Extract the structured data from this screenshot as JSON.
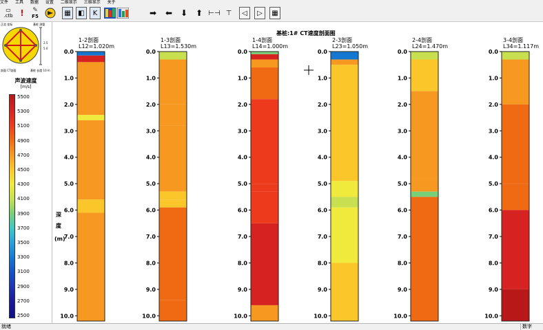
{
  "menu": [
    "文件",
    "工具",
    "数据",
    "设置",
    "二维显示",
    "三维显示",
    "关于"
  ],
  "toolbar": {
    "ctb_label": ".ctb",
    "f5_label": "F5",
    "icons": [
      "open-file-icon",
      "alert-icon",
      "run-icon",
      "profile-select-icon",
      "pattern-icon",
      "edit-icon",
      "color-map-icon",
      "multi-color-icon",
      "arrow-right-icon",
      "arrow-left-icon",
      "arrow-down-icon",
      "arrow-up-icon",
      "fit-width-icon",
      "fit-height-icon",
      "page-left-icon",
      "page-right-icon",
      "grid-icon"
    ]
  },
  "compass": {
    "top_left": "正北 坐标",
    "top_right": "基桩 测管",
    "bottom_left": "剖面 CT剖面",
    "bottom_right": "基桩 长度 10 m",
    "right_values": [
      "2.5",
      "5.0"
    ]
  },
  "legend": {
    "title": "声波速度",
    "unit": "[m/s]",
    "values": [
      5500,
      5300,
      5100,
      4900,
      4700,
      4500,
      4300,
      4100,
      3900,
      3700,
      3500,
      3300,
      3100,
      2900,
      2700,
      2500
    ],
    "colors": [
      "#b81818",
      "#d72222",
      "#ee3a1c",
      "#f06a14",
      "#f79820",
      "#fbc62a",
      "#f0ea3c",
      "#c8e050",
      "#78d078",
      "#3cc8c8",
      "#28a0dc",
      "#1478d2",
      "#1450c8",
      "#1e32b4",
      "#19199a",
      "#10108a"
    ]
  },
  "chart_data": {
    "type": "heatmap",
    "title": "基桩:1# CT速度剖面图",
    "ylabel": "深度 (m)",
    "ylim": [
      0.0,
      10.2
    ],
    "yticks": [
      "0.0",
      "1.0",
      "2.0",
      "3.0",
      "4.0",
      "5.0",
      "6.0",
      "7.0",
      "8.0",
      "9.0",
      "10.0"
    ],
    "profiles": [
      {
        "name": "1-2剖面",
        "length": "L12=1.020m",
        "segments": [
          [
            0.0,
            0.15,
            3200
          ],
          [
            0.15,
            0.4,
            5300
          ],
          [
            0.4,
            2.4,
            4700
          ],
          [
            2.4,
            2.6,
            4200
          ],
          [
            2.6,
            5.6,
            4600
          ],
          [
            5.6,
            6.1,
            4400
          ],
          [
            6.1,
            10.2,
            4600
          ]
        ]
      },
      {
        "name": "1-3剖面",
        "length": "L13=1.530m",
        "segments": [
          [
            0.0,
            0.3,
            4100
          ],
          [
            0.3,
            2.0,
            4600
          ],
          [
            2.0,
            2.8,
            4750
          ],
          [
            2.8,
            5.3,
            4600
          ],
          [
            5.3,
            5.6,
            4400
          ],
          [
            5.6,
            5.9,
            4500
          ],
          [
            5.9,
            9.4,
            4850
          ],
          [
            9.4,
            10.2,
            4900
          ]
        ]
      },
      {
        "name": "1-4剖面",
        "length": "L14=1.000m",
        "segments": [
          [
            0.0,
            0.1,
            3900
          ],
          [
            0.1,
            0.3,
            5300
          ],
          [
            0.3,
            0.6,
            4600
          ],
          [
            0.6,
            1.8,
            4850
          ],
          [
            1.8,
            5.0,
            5050
          ],
          [
            5.0,
            5.3,
            5150
          ],
          [
            5.3,
            6.5,
            5050
          ],
          [
            6.5,
            9.6,
            5300
          ],
          [
            9.6,
            10.2,
            4600
          ]
        ]
      },
      {
        "name": "2-3剖面",
        "length": "L23=1.050m",
        "segments": [
          [
            0.0,
            0.3,
            3200
          ],
          [
            0.3,
            0.5,
            4600
          ],
          [
            0.5,
            4.9,
            4500
          ],
          [
            4.9,
            5.5,
            4350
          ],
          [
            5.5,
            5.9,
            4000
          ],
          [
            5.9,
            8.0,
            4300
          ],
          [
            8.0,
            10.2,
            4400
          ]
        ]
      },
      {
        "name": "2-4剖面",
        "length": "L24=1.470m",
        "segments": [
          [
            0.0,
            0.3,
            4100
          ],
          [
            0.3,
            1.5,
            4550
          ],
          [
            1.5,
            4.8,
            4750
          ],
          [
            4.8,
            5.3,
            4700
          ],
          [
            5.3,
            5.5,
            3900
          ],
          [
            5.5,
            10.2,
            4850
          ]
        ]
      },
      {
        "name": "3-4剖面",
        "length": "L34=1.117m",
        "segments": [
          [
            0.0,
            0.3,
            4000
          ],
          [
            0.3,
            2.0,
            4600
          ],
          [
            2.0,
            5.0,
            4800
          ],
          [
            5.0,
            6.0,
            4900
          ],
          [
            6.0,
            9.0,
            5250
          ],
          [
            9.0,
            10.2,
            5500
          ]
        ]
      }
    ]
  },
  "status": {
    "left": "就绪",
    "right": "数字"
  }
}
